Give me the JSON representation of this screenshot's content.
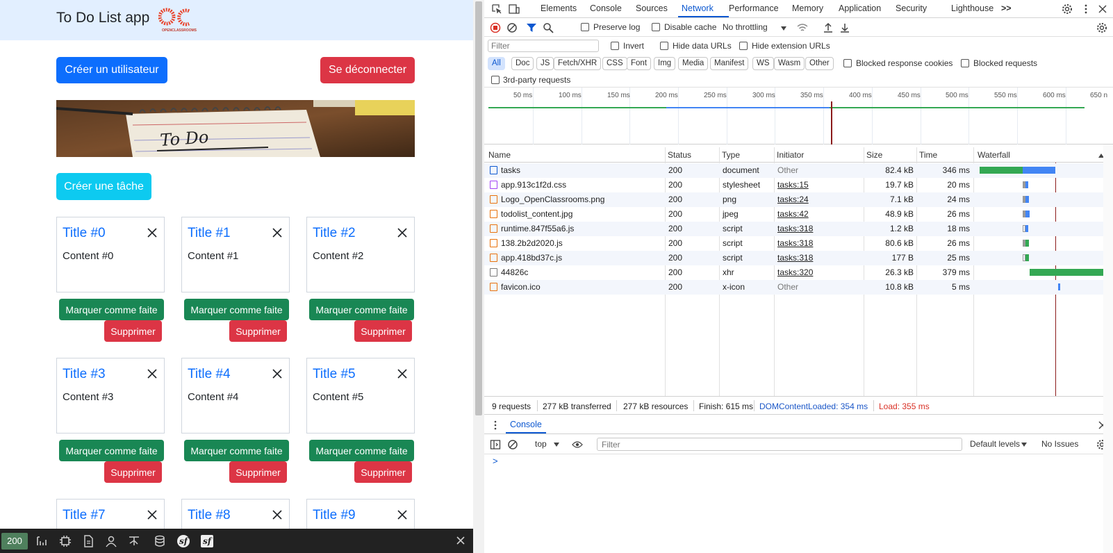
{
  "app": {
    "title": "To Do List app",
    "logo_text": "OPENCLASSROOMS",
    "create_user_label": "Créer un utilisateur",
    "logout_label": "Se déconnecter",
    "banner_text": "To Do",
    "create_task_label": "Créer une tâche",
    "done_label": "Marquer comme faite",
    "delete_label": "Supprimer",
    "tasks": [
      {
        "title": "Title #0",
        "content": "Content #0"
      },
      {
        "title": "Title #1",
        "content": "Content #1"
      },
      {
        "title": "Title #2",
        "content": "Content #2"
      },
      {
        "title": "Title #3",
        "content": "Content #3"
      },
      {
        "title": "Title #4",
        "content": "Content #4"
      },
      {
        "title": "Title #5",
        "content": "Content #5"
      },
      {
        "title": "Title #7",
        "content": ""
      },
      {
        "title": "Title #8",
        "content": ""
      },
      {
        "title": "Title #9",
        "content": ""
      }
    ]
  },
  "symfony_toolbar": {
    "status": "200",
    "status_color": "#4f805d",
    "icons": [
      "timeline-icon",
      "cpu-icon",
      "document-icon",
      "user-icon",
      "tree-icon",
      "database-icon",
      "symfony-icon",
      "symfony-config-icon"
    ]
  },
  "devtools": {
    "tabs": [
      "Elements",
      "Console",
      "Sources",
      "Network",
      "Performance",
      "Memory",
      "Application",
      "Security",
      "Lighthouse"
    ],
    "active_tab": "Network",
    "more_tabs": ">>",
    "toolbar": {
      "preserve_log": "Preserve log",
      "disable_cache": "Disable cache",
      "throttling": "No throttling"
    },
    "filter": {
      "placeholder": "Filter",
      "invert": "Invert",
      "hide_data_urls": "Hide data URLs",
      "hide_extension_urls": "Hide extension URLs"
    },
    "types": [
      "All",
      "Doc",
      "JS",
      "Fetch/XHR",
      "CSS",
      "Font",
      "Img",
      "Media",
      "Manifest",
      "WS",
      "Wasm",
      "Other"
    ],
    "blocked_cookies": "Blocked response cookies",
    "blocked_requests": "Blocked requests",
    "third_party": "3rd-party requests",
    "timeline_ticks": [
      "50 ms",
      "100 ms",
      "150 ms",
      "200 ms",
      "250 ms",
      "300 ms",
      "350 ms",
      "400 ms",
      "450 ms",
      "500 ms",
      "550 ms",
      "600 ms",
      "650 n"
    ],
    "columns": [
      "Name",
      "Status",
      "Type",
      "Initiator",
      "Size",
      "Time",
      "Waterfall"
    ],
    "requests": [
      {
        "name": "tasks",
        "status": "200",
        "type": "document",
        "initiator": "Other",
        "size": "82.4 kB",
        "time": "346 ms",
        "icon": "document-icon"
      },
      {
        "name": "app.913c1f2d.css",
        "status": "200",
        "type": "stylesheet",
        "initiator": "tasks:15",
        "size": "19.7 kB",
        "time": "20 ms",
        "icon": "stylesheet-icon"
      },
      {
        "name": "Logo_OpenClassrooms.png",
        "status": "200",
        "type": "png",
        "initiator": "tasks:24",
        "size": "7.1 kB",
        "time": "24 ms",
        "icon": "image-icon"
      },
      {
        "name": "todolist_content.jpg",
        "status": "200",
        "type": "jpeg",
        "initiator": "tasks:42",
        "size": "48.9 kB",
        "time": "26 ms",
        "icon": "image-icon"
      },
      {
        "name": "runtime.847f55a6.js",
        "status": "200",
        "type": "script",
        "initiator": "tasks:318",
        "size": "1.2 kB",
        "time": "18 ms",
        "icon": "script-icon"
      },
      {
        "name": "138.2b2d2020.js",
        "status": "200",
        "type": "script",
        "initiator": "tasks:318",
        "size": "80.6 kB",
        "time": "26 ms",
        "icon": "script-icon"
      },
      {
        "name": "app.418bd37c.js",
        "status": "200",
        "type": "script",
        "initiator": "tasks:318",
        "size": "177 B",
        "time": "25 ms",
        "icon": "script-icon"
      },
      {
        "name": "44826c",
        "status": "200",
        "type": "xhr",
        "initiator": "tasks:320",
        "size": "26.3 kB",
        "time": "379 ms",
        "icon": "xhr-icon"
      },
      {
        "name": "favicon.ico",
        "status": "200",
        "type": "x-icon",
        "initiator": "Other",
        "size": "10.8 kB",
        "time": "5 ms",
        "icon": "image-icon"
      }
    ],
    "summary": {
      "requests": "9 requests",
      "transferred": "277 kB transferred",
      "resources": "277 kB resources",
      "finish": "Finish: 615 ms",
      "dcl": "DOMContentLoaded: 354 ms",
      "load": "Load: 355 ms",
      "dcl_color": "#1a56c7",
      "load_color": "#d93025"
    },
    "drawer": {
      "tab": "Console",
      "context": "top",
      "filter_placeholder": "Filter",
      "levels": "Default levels",
      "issues": "No Issues",
      "prompt": ">"
    }
  }
}
